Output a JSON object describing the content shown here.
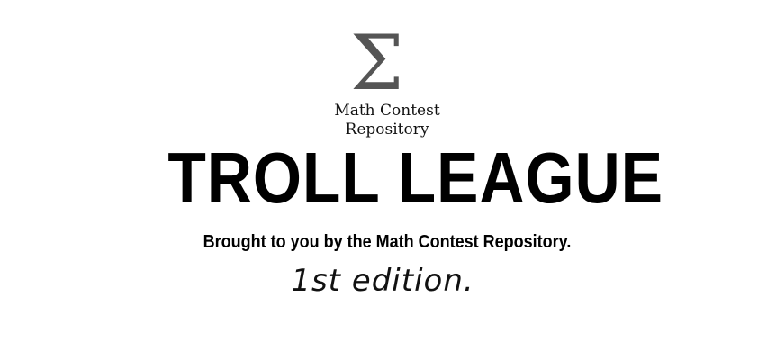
{
  "logo": {
    "mark": "Σ",
    "name_line_1": "Math Contest",
    "name_line_2": "Repository"
  },
  "headline": "TROLL LEAGUE",
  "tagline": "Brought to you by the Math Contest Repository.",
  "edition": "1st edition."
}
